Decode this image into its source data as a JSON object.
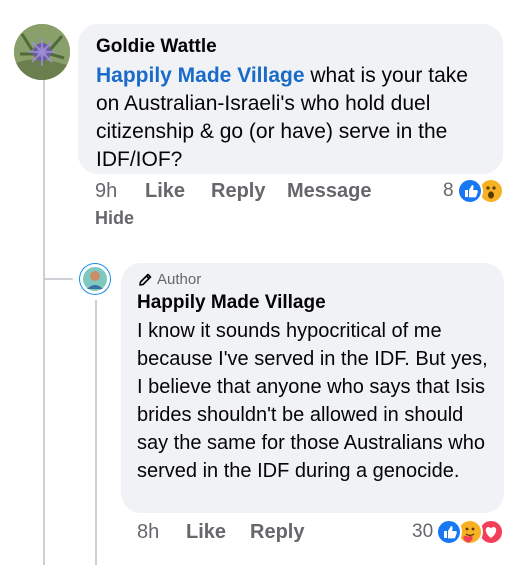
{
  "comment": {
    "author": "Goldie Wattle",
    "mention": "Happily Made Village",
    "text": " what is your take on Australian-Israeli's who hold duel citizenship & go (or have) serve in the IDF/IOF?",
    "time": "9h",
    "like_label": "Like",
    "reply_label": "Reply",
    "message_label": "Message",
    "hide_label": "Hide",
    "reaction_count": "8",
    "reactions": [
      "like-icon",
      "wow-icon"
    ]
  },
  "reply": {
    "badge": "Author",
    "author": "Happily Made Village",
    "text": "I know it sounds hypocritical of me because I've served in the IDF. But yes, I believe that anyone who says that Isis brides shouldn't be allowed in should say the same for those Australians who served in the IDF during a genocide.",
    "time": "8h",
    "like_label": "Like",
    "reply_label": "Reply",
    "reaction_count": "30",
    "reactions": [
      "like-icon",
      "care-icon",
      "love-icon"
    ]
  },
  "colors": {
    "bubble": "#f0f2f5",
    "link": "#1a6bc9",
    "like_blue": "#1877f2",
    "love_red": "#f33e58",
    "wow_yellow": "#f7b125"
  }
}
